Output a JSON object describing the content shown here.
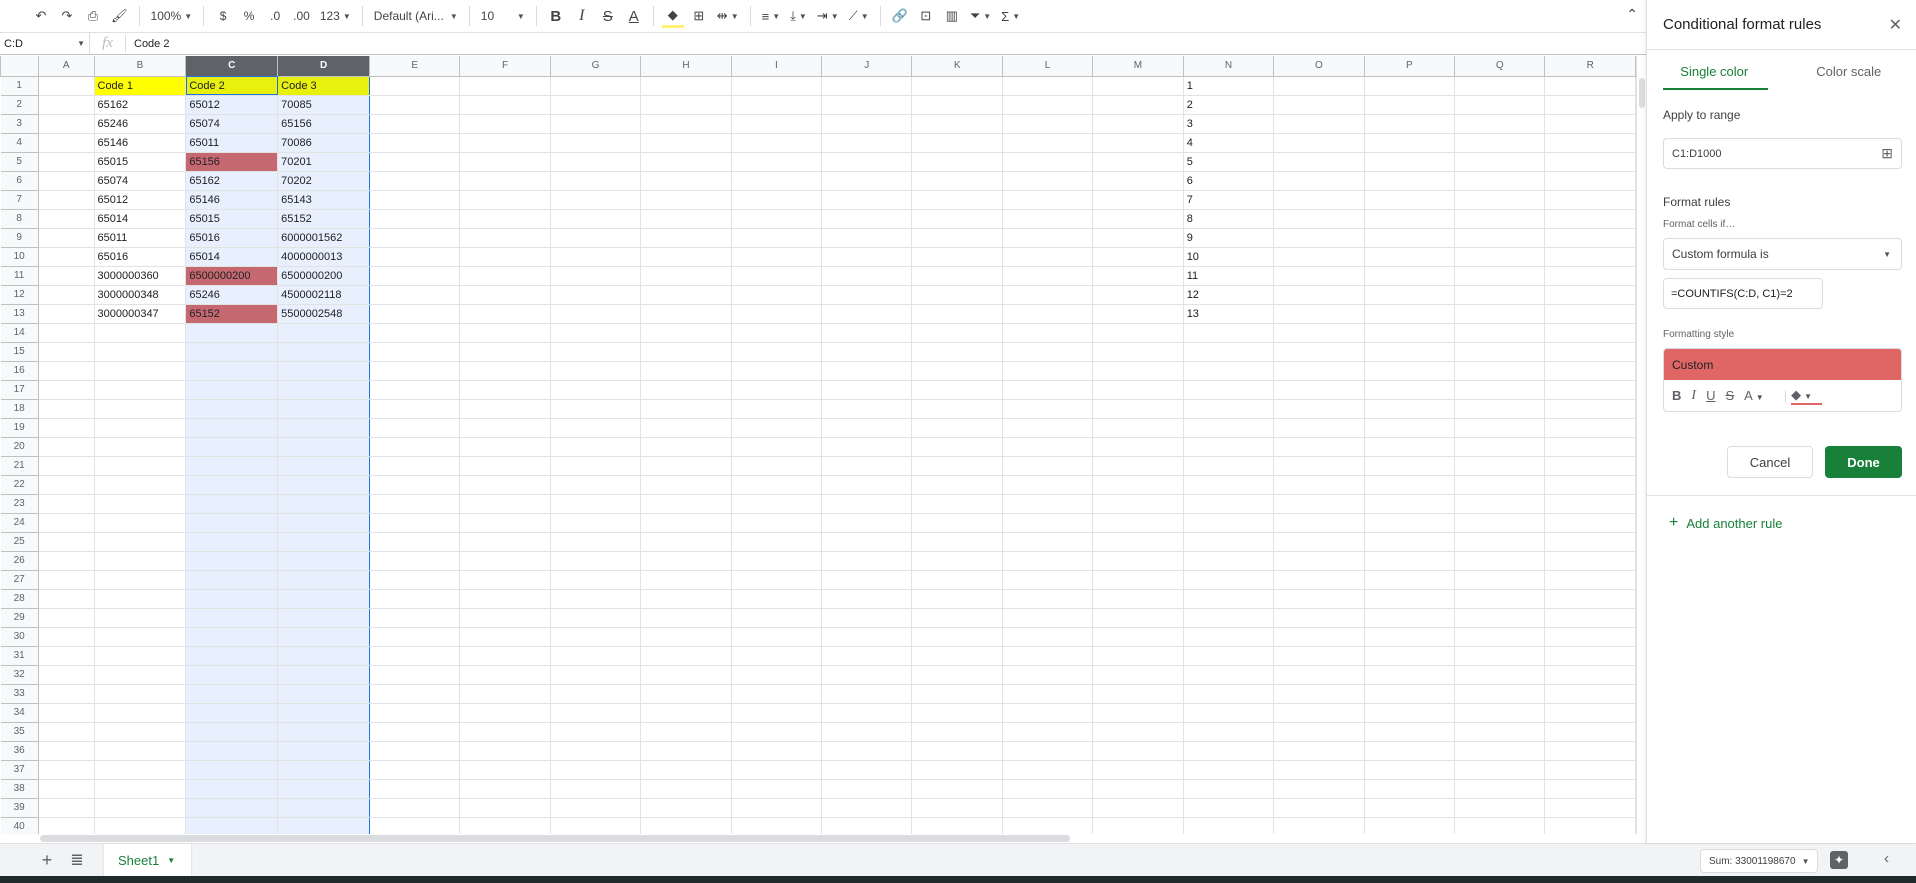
{
  "toolbar": {
    "zoom": "100%",
    "currency": "$",
    "percent": "%",
    "decrease_decimal": ".0",
    "increase_decimal": ".00",
    "more_formats": "123",
    "font": "Default (Ari...",
    "font_size": "10",
    "icons": [
      "undo-icon",
      "redo-icon",
      "print-icon",
      "paint-format-icon",
      "bold-icon",
      "italic-icon",
      "strikethrough-icon",
      "text-color-icon",
      "fill-color-icon",
      "borders-icon",
      "merge-icon",
      "align-icon",
      "valign-icon",
      "wrap-icon",
      "rotate-icon",
      "link-icon",
      "comment-icon",
      "chart-icon",
      "filter-icon",
      "functions-icon"
    ]
  },
  "formula_bar": {
    "name_box": "C:D",
    "fx": "fx",
    "content": "Code 2"
  },
  "columns": [
    "A",
    "B",
    "C",
    "D",
    "E",
    "F",
    "G",
    "H",
    "I",
    "J",
    "K",
    "L",
    "M",
    "N",
    "O",
    "P",
    "Q",
    "R"
  ],
  "selected_columns": [
    "C",
    "D"
  ],
  "rows": [
    {
      "n": "1",
      "b": "Code 1",
      "c": "Code 2",
      "d": "Code 3"
    },
    {
      "n": "2",
      "b": "65162",
      "c": "65012",
      "d": "70085"
    },
    {
      "n": "3",
      "b": "65246",
      "c": "65074",
      "d": "65156"
    },
    {
      "n": "4",
      "b": "65146",
      "c": "65011",
      "d": "70086"
    },
    {
      "n": "5",
      "b": "65015",
      "c": "65156",
      "d": "70201",
      "c_hl": true
    },
    {
      "n": "6",
      "b": "65074",
      "c": "65162",
      "d": "70202"
    },
    {
      "n": "7",
      "b": "65012",
      "c": "65146",
      "d": "65143"
    },
    {
      "n": "8",
      "b": "65014",
      "c": "65015",
      "d": "65152"
    },
    {
      "n": "9",
      "b": "65011",
      "c": "65016",
      "d": "6000001562"
    },
    {
      "n": "10",
      "b": "65016",
      "c": "65014",
      "d": "4000000013"
    },
    {
      "n": "11",
      "b": "3000000360",
      "c": "6500000200",
      "d": "6500000200",
      "c_hl": true
    },
    {
      "n": "12",
      "b": "3000000348",
      "c": "65246",
      "d": "4500002118"
    },
    {
      "n": "13",
      "b": "3000000347",
      "c": "65152",
      "d": "5500002548",
      "c_hl": true
    }
  ],
  "total_rows": 40,
  "colors": {
    "header_yellow": "#ffff00",
    "highlight_red": "#c66870",
    "selection_blue": "#e8f0fe",
    "accent_green": "#188038",
    "custom_style": "#e06666"
  },
  "bottom": {
    "sheet_tab": "Sheet1",
    "sum": "Sum: 33001198670"
  },
  "panel": {
    "title": "Conditional format rules",
    "tabs": [
      "Single color",
      "Color scale"
    ],
    "apply_label": "Apply to range",
    "range": "C1:D1000",
    "format_rules_label": "Format rules",
    "format_cells_if": "Format cells if…",
    "condition": "Custom formula is",
    "formula": "=COUNTIFS(C:D, C1)=2",
    "formatting_style_label": "Formatting style",
    "style_preview": "Custom",
    "cancel": "Cancel",
    "done": "Done",
    "add_rule": "Add another rule"
  }
}
